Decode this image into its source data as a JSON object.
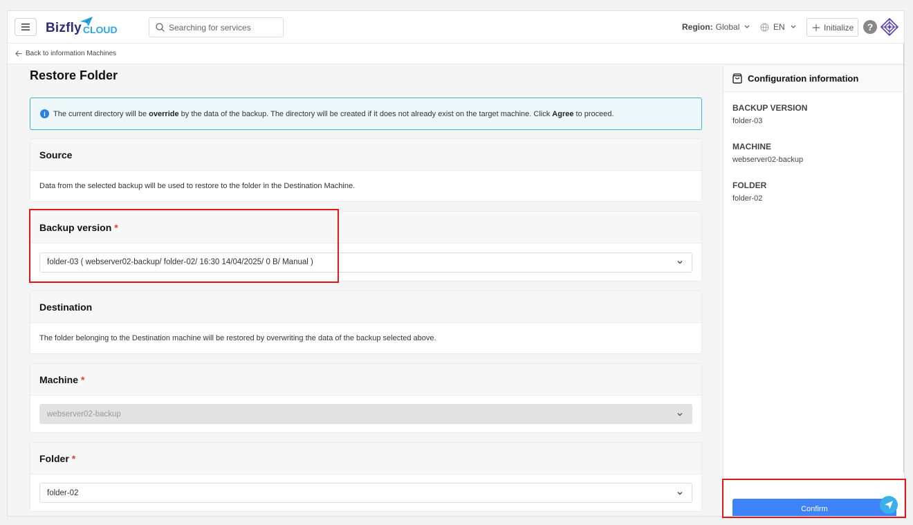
{
  "header": {
    "logo_main": "Bizfly",
    "logo_sub": "CLOUD",
    "search_placeholder": "Searching for services",
    "region_label": "Region:",
    "region_value": "Global",
    "language": "EN",
    "initialize_label": "Initialize",
    "help_glyph": "?"
  },
  "breadcrumb": {
    "back_label": "Back to information Machines"
  },
  "page": {
    "title": "Restore Folder"
  },
  "alert": {
    "part1": "The current directory will be ",
    "bold1": "override",
    "part2": " by the data of the backup. The directory will be created if it does not already exist on the target machine. Click ",
    "bold2": "Agree",
    "part3": " to proceed."
  },
  "source": {
    "title": "Source",
    "description": "Data from the selected backup will be used to restore to the folder in the Destination Machine."
  },
  "backup_version": {
    "title": "Backup version",
    "required_mark": "*",
    "selected": "folder-03 ( webserver02-backup/ folder-02/ 16:30 14/04/2025/ 0 B/ Manual )"
  },
  "destination": {
    "title": "Destination",
    "description": "The folder belonging to the Destination machine will be restored by overwriting the data of the backup selected above."
  },
  "machine": {
    "title": "Machine",
    "required_mark": "*",
    "selected": "webserver02-backup"
  },
  "folder": {
    "title": "Folder",
    "required_mark": "*",
    "selected": "folder-02"
  },
  "config_panel": {
    "title": "Configuration information",
    "items": [
      {
        "label": "BACKUP VERSION",
        "value": "folder-03"
      },
      {
        "label": "MACHINE",
        "value": "webserver02-backup"
      },
      {
        "label": "FOLDER",
        "value": "folder-02"
      }
    ],
    "confirm_label": "Confirm"
  },
  "colors": {
    "primary": "#3f83f8",
    "highlight": "#e0161b",
    "required": "#e4422d",
    "alert_border": "#3bb5cc",
    "brand_dark": "#2b2d7c",
    "brand_light": "#2aa6e0"
  }
}
